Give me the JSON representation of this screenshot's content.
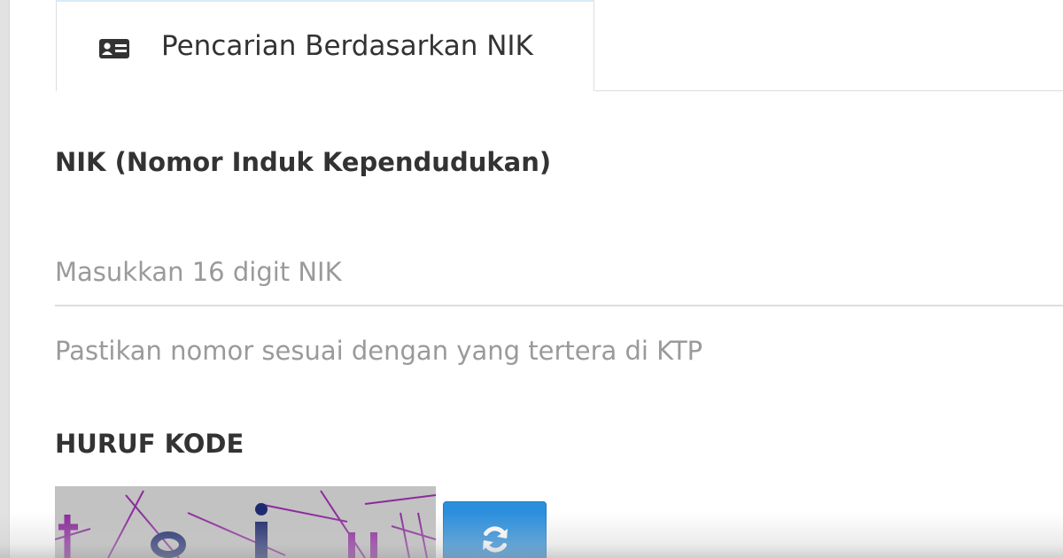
{
  "tab": {
    "label": "Pencarian Berdasarkan NIK",
    "icon": "id-card-icon"
  },
  "nik_field": {
    "label": "NIK (Nomor Induk Kependudukan)",
    "placeholder": "Masukkan 16 digit NIK",
    "value": "",
    "help": "Pastikan nomor sesuai dengan yang tertera di KTP"
  },
  "captcha": {
    "label": "HURUF KODE",
    "image_icon": "captcha-image",
    "refresh_icon": "refresh-icon"
  },
  "colors": {
    "accent": "#2b8fdd",
    "text": "#333333",
    "muted": "#9a9a9a",
    "captcha_ink": "#8b2a9c",
    "captcha_char": "#1e2a6e"
  }
}
